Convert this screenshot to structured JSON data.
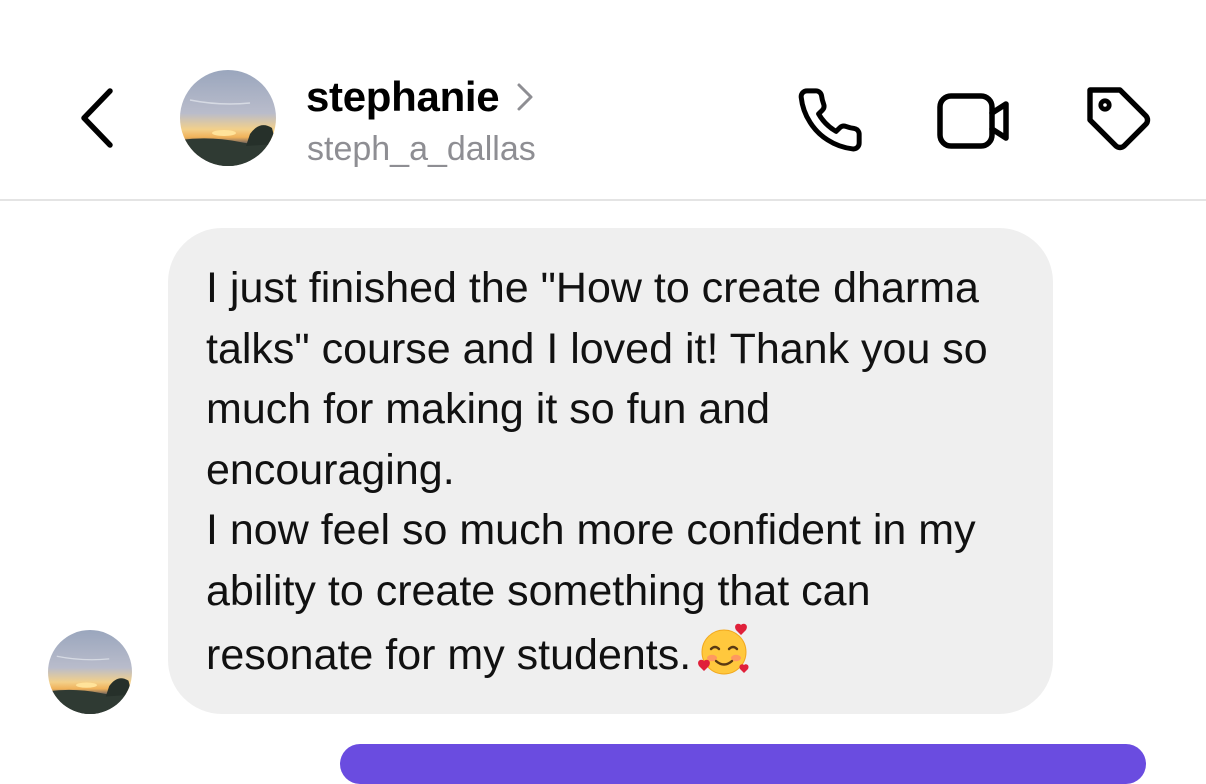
{
  "header": {
    "display_name": "stephanie",
    "username": "steph_a_dallas",
    "icons": {
      "back": "chevron-left-icon",
      "profile_link": "chevron-right-icon",
      "call": "phone-icon",
      "video": "video-camera-icon",
      "tag": "tag-icon"
    }
  },
  "message": {
    "paragraphs": [
      "I just finished the \"How to create dharma talks\" course and I loved it! Thank you so much for making it so fun and encouraging.",
      "I now feel so much more confident in my ability to create something that can resonate for my students."
    ],
    "emoji": "smiling-face-with-hearts"
  },
  "colors": {
    "bubble": "#efefef",
    "secondary_text": "#8e8e93",
    "divider": "#e4e4e4",
    "outgoing_accent": "#6a4ce0"
  }
}
